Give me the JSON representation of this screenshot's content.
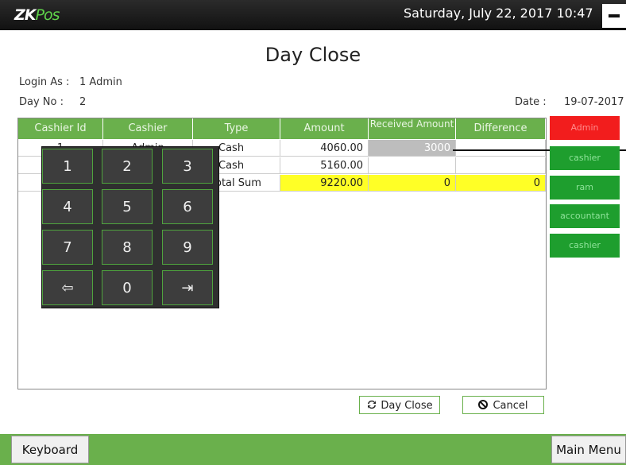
{
  "app": {
    "logo_main": "ZK",
    "logo_sub": "Pos",
    "datetime": "Saturday, July 22, 2017 10:47"
  },
  "page": {
    "title": "Day Close"
  },
  "info": {
    "login_label": "Login As :",
    "login_value": "1 Admin",
    "dayno_label": "Day No :",
    "dayno_value": "2",
    "date_label": "Date :",
    "date_value": "19-07-2017"
  },
  "table": {
    "headers": {
      "cashier_id": "Cashier Id",
      "cashier": "Cashier",
      "type": "Type",
      "amount": "Amount",
      "received": "Received Amount",
      "difference": "Difference"
    },
    "rows": [
      {
        "cashier_id": "1",
        "cashier": "Admin",
        "type": "Cash",
        "amount": "4060.00",
        "received": "3000",
        "difference": ""
      },
      {
        "cashier_id": "",
        "cashier": "",
        "type": "Cash",
        "amount": "5160.00",
        "received": "",
        "difference": ""
      }
    ],
    "total": {
      "type": "otal Sum",
      "amount": "9220.00",
      "received": "0",
      "difference": "0"
    }
  },
  "keypad": {
    "keys": [
      "1",
      "2",
      "3",
      "4",
      "5",
      "6",
      "7",
      "8",
      "9",
      "⇦",
      "0",
      "⇥"
    ]
  },
  "users": [
    "Admin",
    "cashier",
    "ram",
    "accountant",
    "cashier"
  ],
  "actions": {
    "day_close": "Day Close",
    "cancel": "Cancel"
  },
  "footer": {
    "keyboard": "Keyboard",
    "main_menu": "Main Menu"
  },
  "colors": {
    "accent": "#6ab04c",
    "active_user": "#f21d1d",
    "user": "#1e9e2e",
    "total_row": "#ffff26"
  },
  "icons": [
    "refresh-icon",
    "cancel-icon",
    "minimize-icon",
    "backspace-icon",
    "enter-icon"
  ]
}
